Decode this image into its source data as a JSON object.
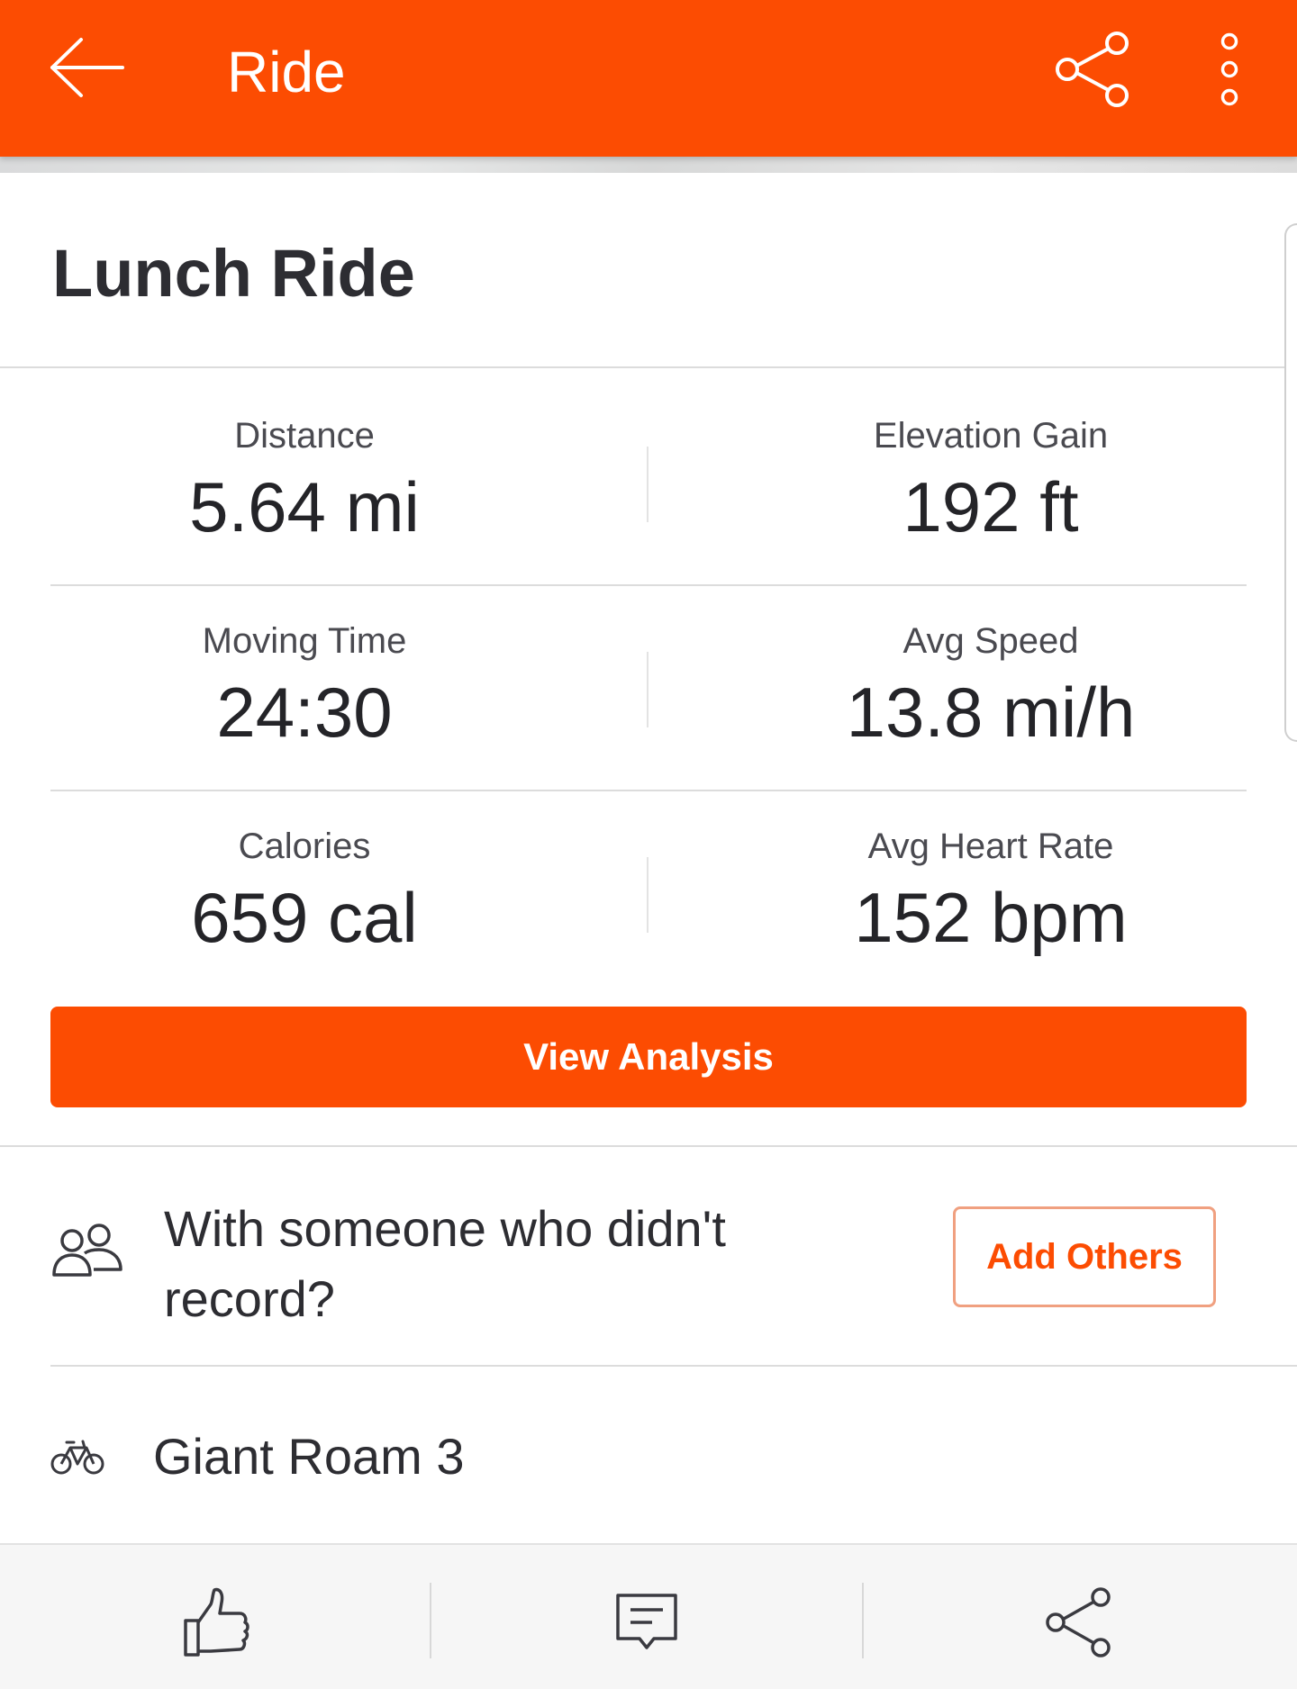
{
  "app_bar": {
    "title": "Ride",
    "back_icon": "arrow-left-icon",
    "share_icon": "share-icon",
    "more_icon": "more-vertical-icon",
    "color": "#fc4c02"
  },
  "activity": {
    "name": "Lunch Ride"
  },
  "stats": [
    {
      "label": "Distance",
      "value": "5.64 mi"
    },
    {
      "label": "Elevation Gain",
      "value": "192 ft"
    },
    {
      "label": "Moving Time",
      "value": "24:30"
    },
    {
      "label": "Avg Speed",
      "value": "13.8 mi/h"
    },
    {
      "label": "Calories",
      "value": "659 cal"
    },
    {
      "label": "Avg Heart Rate",
      "value": "152 bpm"
    }
  ],
  "actions": {
    "view_analysis": "View Analysis"
  },
  "group": {
    "prompt": "With someone who didn't record?",
    "add_others": "Add Others",
    "icon": "people-icon"
  },
  "gear": {
    "name": "Giant Roam 3",
    "icon": "bike-icon"
  },
  "bottom_bar": {
    "items": [
      "thumbs-up-icon",
      "comment-icon",
      "share-icon"
    ]
  }
}
